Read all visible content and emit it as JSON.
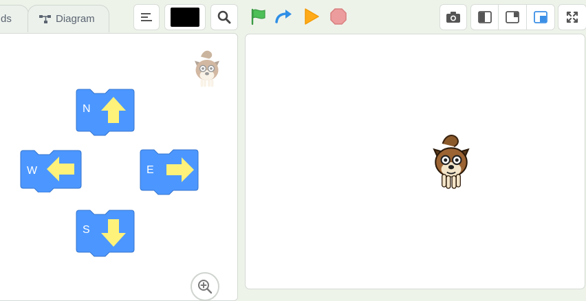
{
  "tabs": [
    {
      "label": "ds",
      "icon": "blocks-icon"
    },
    {
      "label": "Diagram",
      "icon": "diagram-icon"
    }
  ],
  "toolbar": {
    "align_icon": "align-left-icon",
    "color_swatch": "#000000",
    "search_icon": "search-icon",
    "run_icons": [
      "green-flag-icon",
      "step-arrow-icon",
      "play-icon",
      "stop-icon"
    ]
  },
  "view_controls": [
    "camera-icon",
    "layout-left-icon",
    "layout-right-icon",
    "layout-small-stage-icon",
    "fullscreen-icon"
  ],
  "blocks": [
    {
      "label": "N",
      "direction": "up"
    },
    {
      "label": "W",
      "direction": "left"
    },
    {
      "label": "E",
      "direction": "right"
    },
    {
      "label": "S",
      "direction": "down"
    }
  ],
  "colors": {
    "block_blue": "#4c97ff",
    "arrow_yellow": "#fff27a",
    "flag_green": "#4cbf56",
    "step_blue": "#2f8fe6",
    "play_orange": "#ffab19",
    "stop_red": "#ec9c9c",
    "active_blue": "#3b8fe6"
  }
}
